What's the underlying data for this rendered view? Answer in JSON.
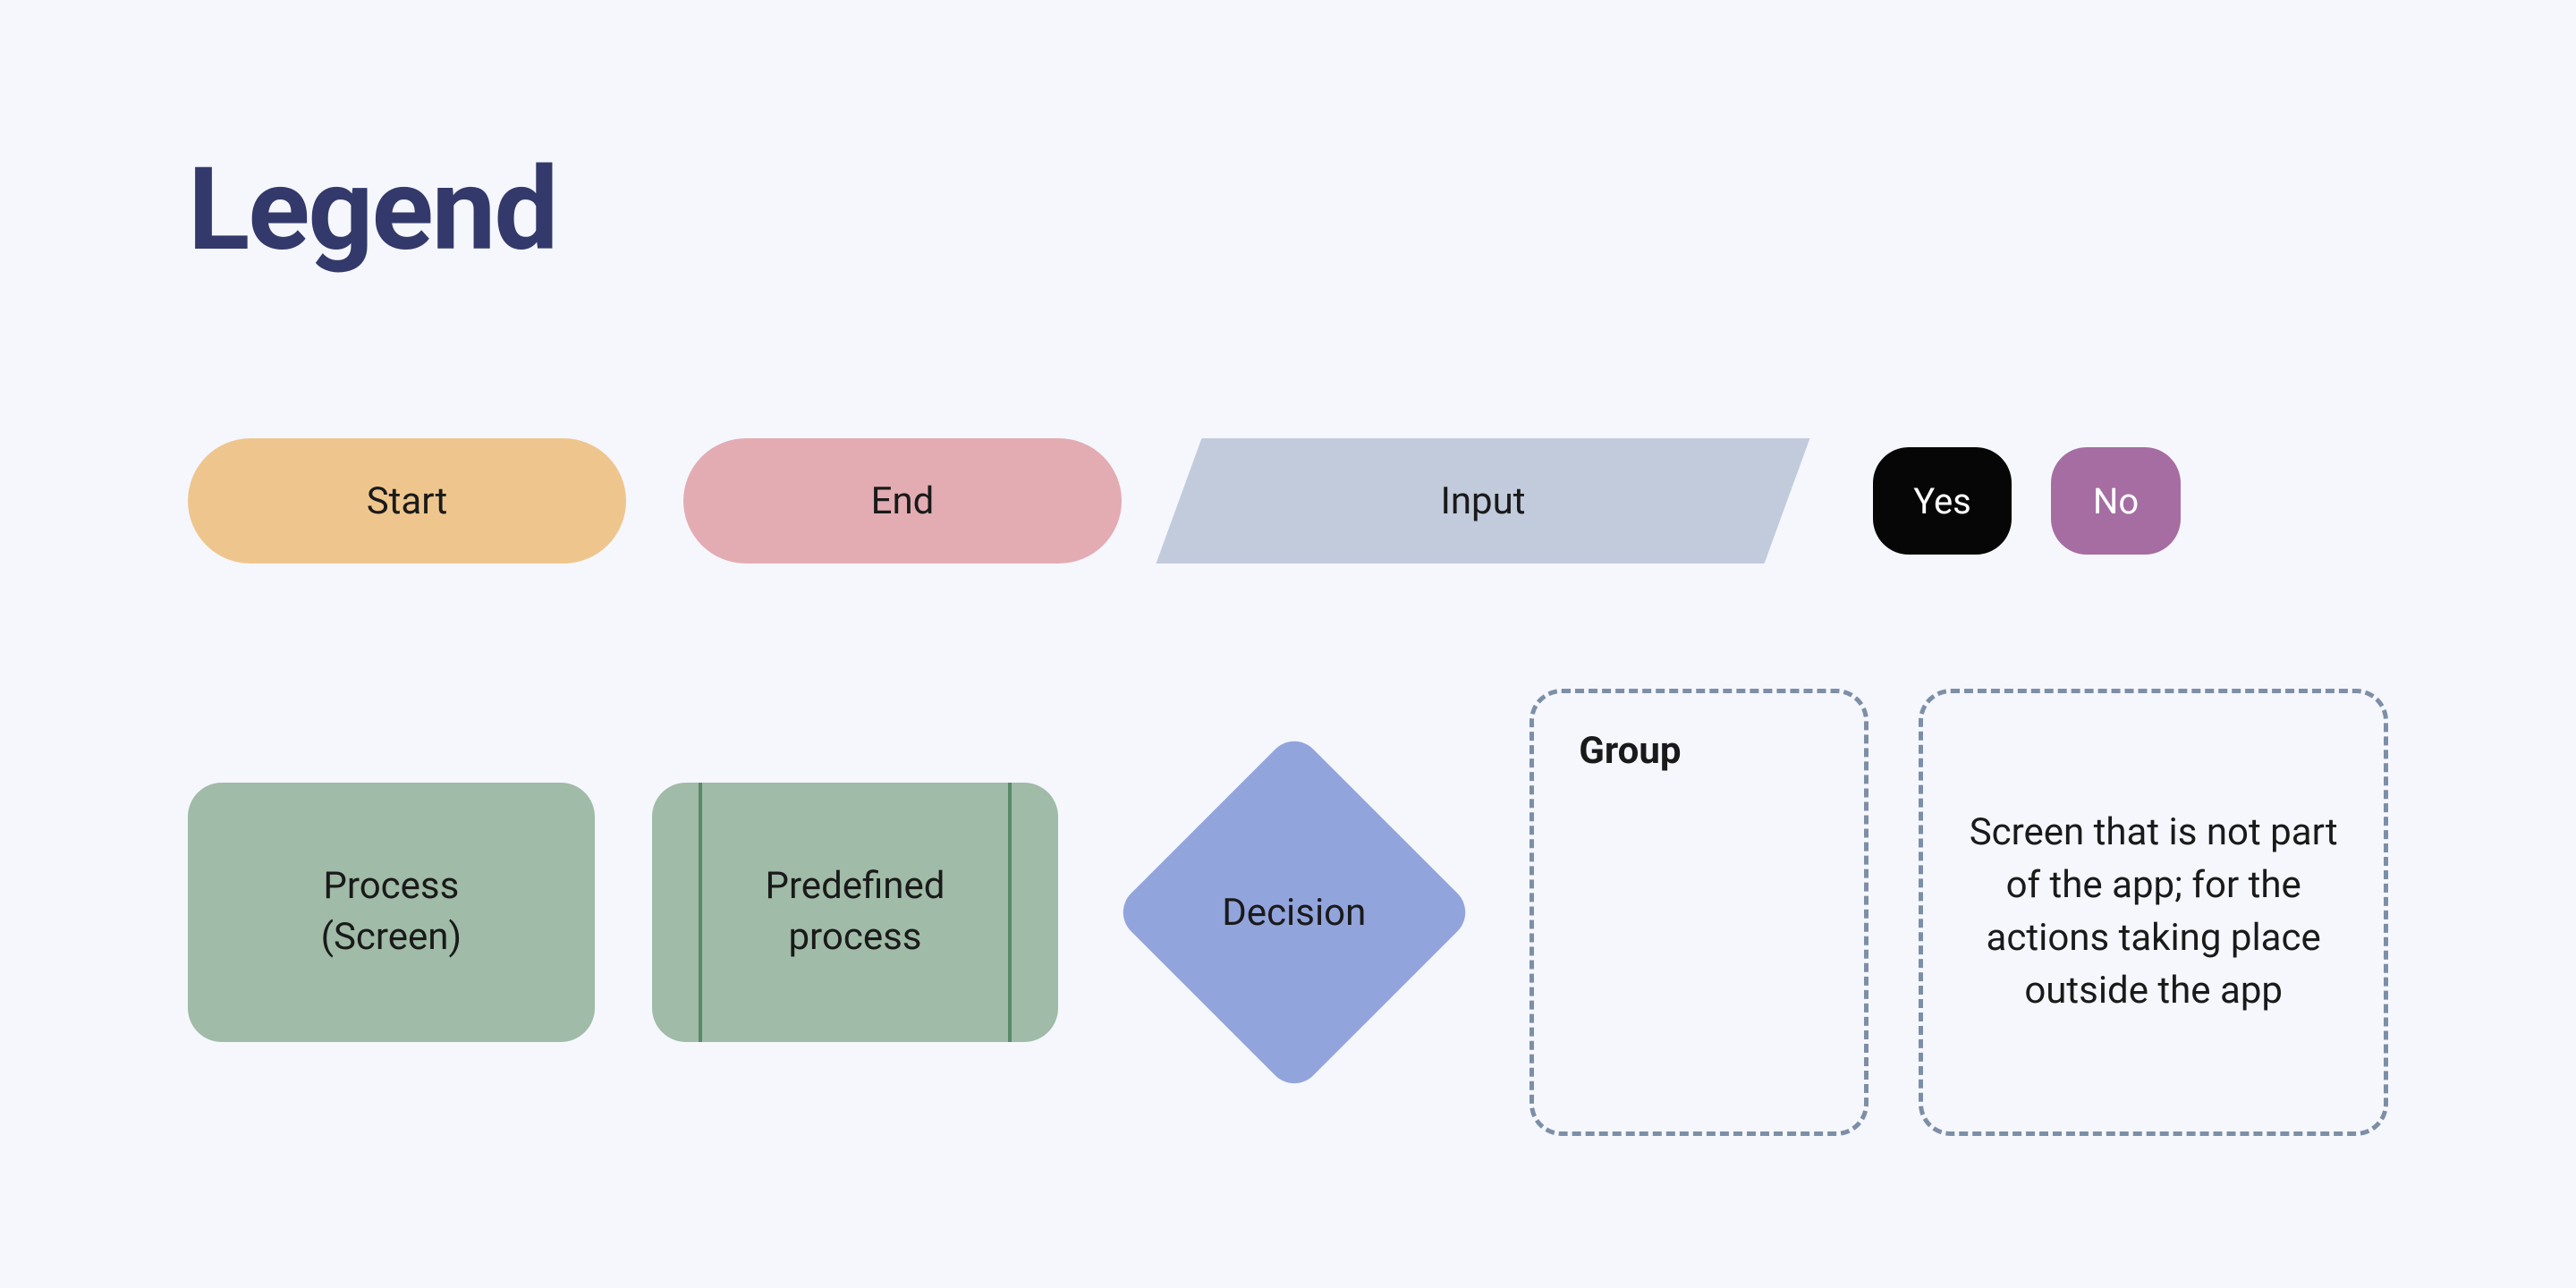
{
  "title": "Legend",
  "shapes": {
    "start": "Start",
    "end": "End",
    "input": "Input",
    "yes": "Yes",
    "no": "No",
    "process_line1": "Process",
    "process_line2": "(Screen)",
    "predefined_line1": "Predefined",
    "predefined_line2": "process",
    "decision": "Decision",
    "group": "Group",
    "external_screen": "Screen that is not part of the app; for the actions taking place outside the app"
  },
  "colors": {
    "background": "#f5f7fc",
    "title": "#33396a",
    "start": "#eec68d",
    "end": "#e3acb2",
    "input": "#c1cbdc",
    "yes_bg": "#060606",
    "no_bg": "#a66da2",
    "process": "#a0bba7",
    "decision": "#92a4dc",
    "dashed_border": "#7d8fa7"
  }
}
